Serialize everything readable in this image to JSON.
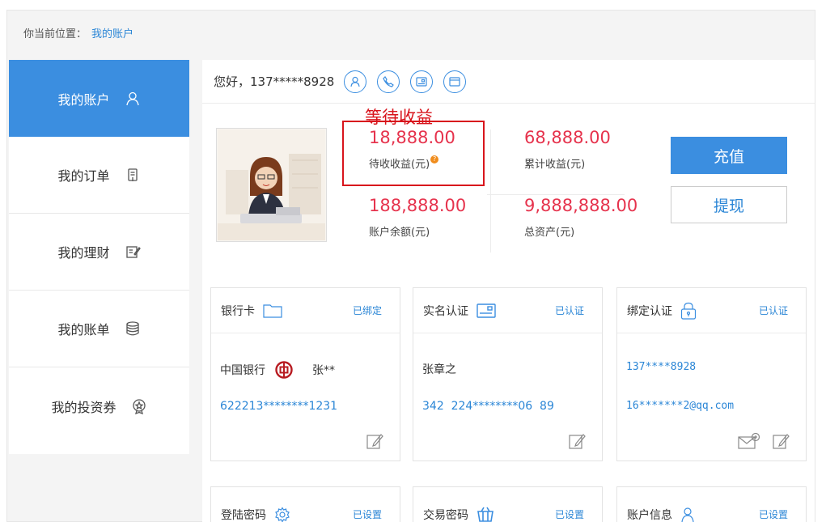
{
  "breadcrumb": {
    "prefix": "你当前位置：",
    "current": "我的账户"
  },
  "sidebar": {
    "items": [
      {
        "label": "我的账户",
        "icon": "user-icon",
        "active": true
      },
      {
        "label": "我的订单",
        "icon": "order-icon",
        "active": false
      },
      {
        "label": "我的理财",
        "icon": "finance-icon",
        "active": false
      },
      {
        "label": "我的账单",
        "icon": "bill-icon",
        "active": false
      },
      {
        "label": "我的投资券",
        "icon": "coupon-icon",
        "active": false
      }
    ]
  },
  "greeting": {
    "text": "您好，137*****8928",
    "icons": [
      "user-verify-icon",
      "phone-icon",
      "id-card-icon",
      "bank-card-icon"
    ]
  },
  "annotation": {
    "label": "等待收益"
  },
  "stats": {
    "pending": {
      "value": "18,888.00",
      "label": "待收收益(元)",
      "help": "?"
    },
    "cumulative": {
      "value": "68,888.00",
      "label": "累计收益(元)"
    },
    "balance": {
      "value": "188,888.00",
      "label": "账户余额(元)"
    },
    "total": {
      "value": "9,888,888.00",
      "label": "总资产(元)"
    }
  },
  "actions": {
    "recharge": "充值",
    "withdraw": "提现"
  },
  "cards": {
    "bank": {
      "title": "银行卡",
      "status": "已绑定",
      "bank_name": "中国银行",
      "holder": "张**",
      "number": "622213********1231"
    },
    "realname": {
      "title": "实名认证",
      "status": "已认证",
      "name": "张章之",
      "id_number": "342  224********06  89"
    },
    "binding": {
      "title": "绑定认证",
      "status": "已认证",
      "phone": "137****8928",
      "email": "16*******2@qq.com"
    },
    "login_pwd": {
      "title": "登陆密码",
      "status": "已设置"
    },
    "trade_pwd": {
      "title": "交易密码",
      "status": "已设置"
    },
    "account_info": {
      "title": "账户信息",
      "status": "已设置"
    }
  },
  "colors": {
    "accent": "#3b8ee0",
    "highlight": "#e6334d",
    "annotation": "#d8141c",
    "link": "#2b86d6",
    "warning": "#f08c1c"
  }
}
